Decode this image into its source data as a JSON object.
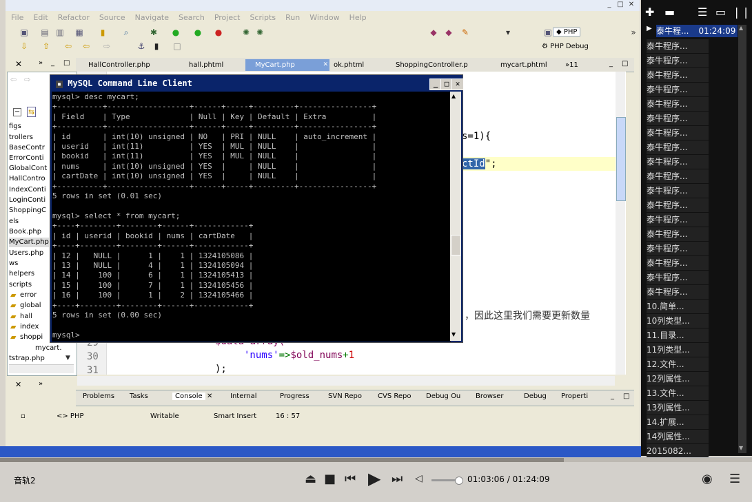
{
  "eclipse": {
    "menu": [
      "File",
      "Edit",
      "Refactor",
      "Source",
      "Navigate",
      "Search",
      "Project",
      "Scripts",
      "Run",
      "Window",
      "Help"
    ],
    "perspective_php": "PHP",
    "perspective_debug": "PHP Debug",
    "tabs": [
      {
        "label": "HallController.php",
        "active": false
      },
      {
        "label": "hall.phtml",
        "active": false
      },
      {
        "label": "MyCart.php",
        "active": true
      },
      {
        "label": "ok.phtml",
        "active": false
      },
      {
        "label": "ShoppingController.p",
        "active": false
      },
      {
        "label": "mycart.phtml",
        "active": false
      },
      {
        "label": "»11",
        "active": false
      }
    ],
    "tree": [
      "figs",
      "trollers",
      "BaseContr",
      "ErrorConti",
      "GlobalCont",
      "HallContro",
      "IndexConti",
      "LoginConti",
      "ShoppingC",
      "els",
      "Book.php",
      "MyCart.php",
      "Users.php",
      "ws",
      "helpers",
      "scripts",
      "error",
      "global",
      "hall",
      "index",
      "shoppi",
      "mycart.",
      "tstrap.php"
    ],
    "code_snippets": {
      "s_eq_1": "s=1){",
      "ctid": "ctId",
      "ctid_tail": "\";",
      "comment": "，因此这里我们需要更新数量",
      "l29": "$data=array(",
      "l30": "'nums'=>$old_nums+1",
      "l31": ");"
    },
    "line_numbers": [
      "29",
      "30",
      "31"
    ],
    "bottom_tabs": [
      "Problems",
      "Tasks",
      "Console",
      "Internal",
      "Progress",
      "SVN Repo",
      "CVS Repo",
      "Debug Ou",
      "Browser",
      "Debug",
      "Properti"
    ],
    "status": {
      "lang": "<> PHP",
      "writable": "Writable",
      "insert": "Smart Insert",
      "pos": "16 : 57"
    }
  },
  "mysql": {
    "title": "MySQL Command Line Client",
    "lines": [
      "mysql> desc mycart;",
      "+----------+------------------+------+-----+---------+----------------+",
      "| Field    | Type             | Null | Key | Default | Extra          |",
      "+----------+------------------+------+-----+---------+----------------+",
      "| id       | int(10) unsigned | NO   | PRI | NULL    | auto_increment |",
      "| userid   | int(11)          | YES  | MUL | NULL    |                |",
      "| bookid   | int(11)          | YES  | MUL | NULL    |                |",
      "| nums     | int(10) unsigned | YES  |     | NULL    |                |",
      "| cartDate | int(10) unsigned | YES  |     | NULL    |                |",
      "+----------+------------------+------+-----+---------+----------------+",
      "5 rows in set (0.01 sec)",
      "",
      "mysql> select * from mycart;",
      "+----+--------+--------+------+------------+",
      "| id | userid | bookid | nums | cartDate   |",
      "+----+--------+--------+------+------------+",
      "| 12 |   NULL |      1 |    1 | 1324105086 |",
      "| 13 |   NULL |      4 |    1 | 1324105094 |",
      "| 14 |    100 |      6 |    1 | 1324105413 |",
      "| 15 |    100 |      7 |    1 | 1324105456 |",
      "| 16 |    100 |      1 |    2 | 1324105466 |",
      "+----+--------+--------+------+------------+",
      "5 rows in set (0.00 sec)",
      "",
      "mysql>"
    ]
  },
  "playlist": {
    "current": {
      "title": "泰牛程...",
      "time": "01:24:09"
    },
    "items": [
      "泰牛程序...",
      "泰牛程序...",
      "泰牛程序...",
      "泰牛程序...",
      "泰牛程序...",
      "泰牛程序...",
      "泰牛程序...",
      "泰牛程序...",
      "泰牛程序...",
      "泰牛程序...",
      "泰牛程序...",
      "泰牛程序...",
      "泰牛程序...",
      "泰牛程序...",
      "泰牛程序...",
      "泰牛程序...",
      "泰牛程序...",
      "泰牛程序...",
      "10.简单...",
      "10列类型...",
      "11.目录...",
      "11列类型...",
      "12.文件...",
      "12列属性...",
      "13.文件...",
      "13列属性...",
      "14.扩展...",
      "14列属性...",
      "2015082..."
    ]
  },
  "player": {
    "track": "音轨2",
    "time_current": "01:03:06",
    "time_sep": " / ",
    "time_total": "01:24:09",
    "progress": 0.75
  }
}
